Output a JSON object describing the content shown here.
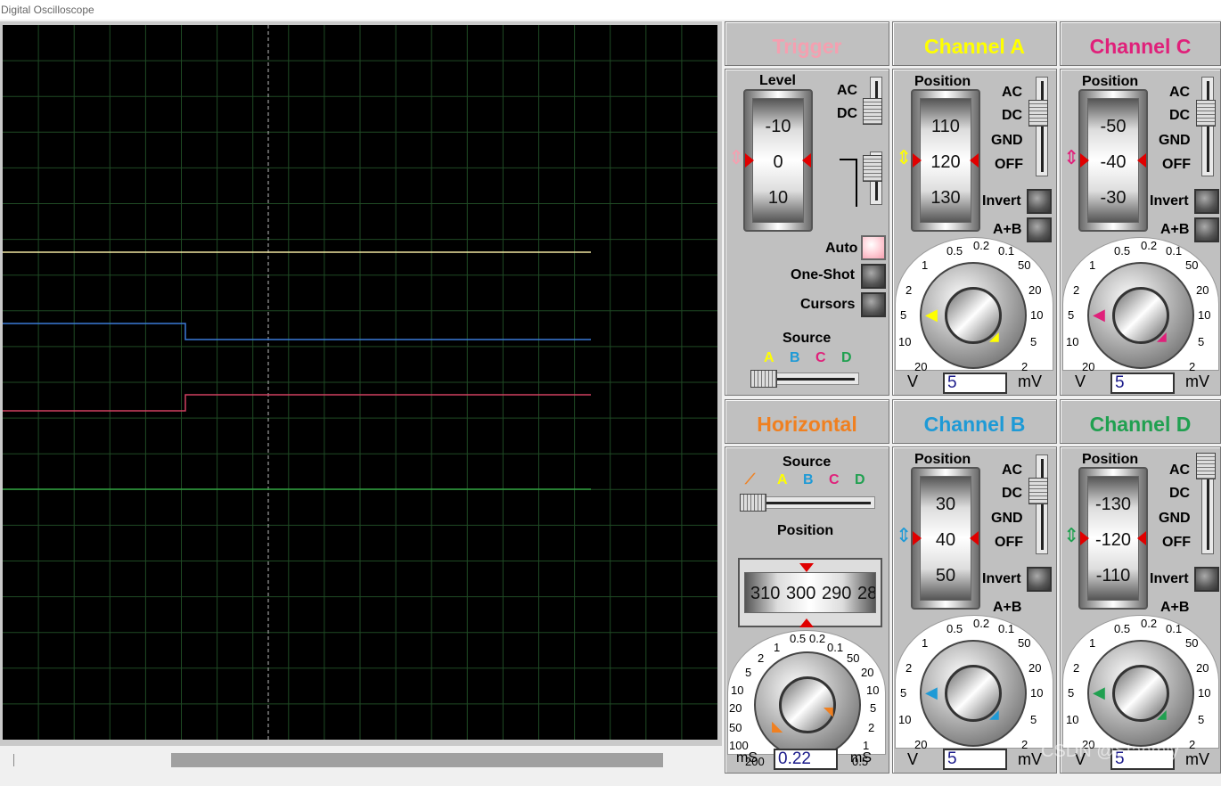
{
  "window": {
    "title": "Digital Oscilloscope"
  },
  "colors": {
    "trigger": "#f4a0b0",
    "channel_a": "#ffff00",
    "channel_b": "#1e9ad6",
    "channel_c": "#e0207a",
    "channel_d": "#20a050",
    "horizontal": "#f08020",
    "trace_a": "#f0e6a0",
    "trace_b": "#3a7ad8",
    "trace_c": "#d04060",
    "trace_d": "#30a040"
  },
  "trigger": {
    "title": "Trigger",
    "level_label": "Level",
    "drum": [
      "-10",
      "0",
      "10"
    ],
    "ac": "AC",
    "dc": "DC",
    "auto": "Auto",
    "one_shot": "One-Shot",
    "cursors": "Cursors",
    "source_label": "Source",
    "sources": [
      "A",
      "B",
      "C",
      "D"
    ]
  },
  "channel_a": {
    "title": "Channel A",
    "position_label": "Position",
    "drum": [
      "110",
      "120",
      "130"
    ],
    "coupling": [
      "AC",
      "DC",
      "GND",
      "OFF"
    ],
    "invert": "Invert",
    "aplusb": "A+B",
    "dial_ticks": [
      "0.5",
      "0.2",
      "0.1",
      "50",
      "20",
      "10",
      "5",
      "2",
      "20",
      "10",
      "5",
      "2",
      "1"
    ],
    "value": "5",
    "unit_left": "V",
    "unit_right": "mV"
  },
  "channel_c": {
    "title": "Channel C",
    "position_label": "Position",
    "drum": [
      "-50",
      "-40",
      "-30"
    ],
    "coupling": [
      "AC",
      "DC",
      "GND",
      "OFF"
    ],
    "invert": "Invert",
    "aplusb": "A+B",
    "dial_ticks": [
      "0.5",
      "0.2",
      "0.1",
      "50",
      "20",
      "10",
      "5",
      "2",
      "20",
      "10",
      "5",
      "2",
      "1"
    ],
    "value": "5",
    "unit_left": "V",
    "unit_right": "mV"
  },
  "horizontal": {
    "title": "Horizontal",
    "source_label": "Source",
    "sources": [
      "A",
      "B",
      "C",
      "D"
    ],
    "position_label": "Position",
    "drum": [
      "310",
      "300",
      "290",
      "28"
    ],
    "dial_ticks": [
      "0.5",
      "0.2",
      "0.1",
      "50",
      "20",
      "10",
      "5",
      "2",
      "1",
      "0.5",
      "200",
      "100",
      "50",
      "20",
      "10",
      "5",
      "2",
      "1"
    ],
    "value": "0.22",
    "unit_left": "mS",
    "unit_right": "mS"
  },
  "channel_b": {
    "title": "Channel B",
    "position_label": "Position",
    "drum": [
      "30",
      "40",
      "50"
    ],
    "coupling": [
      "AC",
      "DC",
      "GND",
      "OFF"
    ],
    "invert": "Invert",
    "aplusb": "A+B",
    "dial_ticks": [
      "0.5",
      "0.2",
      "0.1",
      "50",
      "20",
      "10",
      "5",
      "2",
      "20",
      "10",
      "5",
      "2",
      "1"
    ],
    "value": "5",
    "unit_left": "V",
    "unit_right": "mV"
  },
  "channel_d": {
    "title": "Channel D",
    "position_label": "Position",
    "drum": [
      "-130",
      "-120",
      "-110"
    ],
    "coupling": [
      "AC",
      "DC",
      "GND",
      "OFF"
    ],
    "invert": "Invert",
    "aplusb": "A+B",
    "dial_ticks": [
      "0.5",
      "0.2",
      "0.1",
      "50",
      "20",
      "10",
      "5",
      "2",
      "20",
      "10",
      "5",
      "2",
      "1"
    ],
    "value": "5",
    "unit_left": "V",
    "unit_right": "mV"
  },
  "watermark": "CSDN @Stanmiy"
}
